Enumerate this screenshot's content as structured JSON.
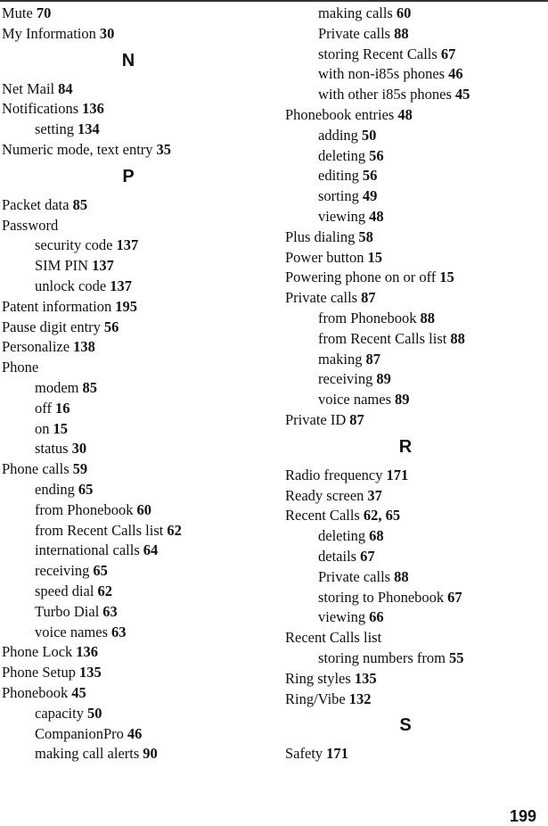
{
  "page_number": "199",
  "columns": [
    {
      "items": [
        {
          "type": "entry",
          "level": 0,
          "term": "Mute",
          "pages": "70"
        },
        {
          "type": "entry",
          "level": 0,
          "term": "My Information",
          "pages": "30"
        },
        {
          "type": "letter",
          "letter": "N"
        },
        {
          "type": "entry",
          "level": 0,
          "term": "Net Mail",
          "pages": "84"
        },
        {
          "type": "entry",
          "level": 0,
          "term": "Notifications",
          "pages": "136"
        },
        {
          "type": "entry",
          "level": 1,
          "term": "setting",
          "pages": "134"
        },
        {
          "type": "entry",
          "level": 0,
          "term": "Numeric mode, text entry",
          "pages": "35"
        },
        {
          "type": "letter",
          "letter": "P"
        },
        {
          "type": "entry",
          "level": 0,
          "term": "Packet data",
          "pages": "85"
        },
        {
          "type": "entry",
          "level": 0,
          "term": "Password",
          "pages": ""
        },
        {
          "type": "entry",
          "level": 1,
          "term": "security code",
          "pages": "137"
        },
        {
          "type": "entry",
          "level": 1,
          "term": "SIM PIN",
          "pages": "137"
        },
        {
          "type": "entry",
          "level": 1,
          "term": "unlock code",
          "pages": "137"
        },
        {
          "type": "entry",
          "level": 0,
          "term": "Patent information",
          "pages": "195"
        },
        {
          "type": "entry",
          "level": 0,
          "term": "Pause digit entry",
          "pages": "56"
        },
        {
          "type": "entry",
          "level": 0,
          "term": "Personalize",
          "pages": "138"
        },
        {
          "type": "entry",
          "level": 0,
          "term": "Phone",
          "pages": ""
        },
        {
          "type": "entry",
          "level": 1,
          "term": "modem",
          "pages": "85"
        },
        {
          "type": "entry",
          "level": 1,
          "term": "off",
          "pages": "16"
        },
        {
          "type": "entry",
          "level": 1,
          "term": "on",
          "pages": "15"
        },
        {
          "type": "entry",
          "level": 1,
          "term": "status",
          "pages": "30"
        },
        {
          "type": "entry",
          "level": 0,
          "term": "Phone calls",
          "pages": "59"
        },
        {
          "type": "entry",
          "level": 1,
          "term": "ending",
          "pages": "65"
        },
        {
          "type": "entry",
          "level": 1,
          "term": "from Phonebook",
          "pages": "60"
        },
        {
          "type": "entry",
          "level": 1,
          "term": "from Recent Calls list",
          "pages": "62"
        },
        {
          "type": "entry",
          "level": 1,
          "term": "international calls",
          "pages": "64"
        },
        {
          "type": "entry",
          "level": 1,
          "term": "receiving",
          "pages": "65"
        },
        {
          "type": "entry",
          "level": 1,
          "term": "speed dial",
          "pages": "62"
        },
        {
          "type": "entry",
          "level": 1,
          "term": "Turbo Dial",
          "pages": "63"
        },
        {
          "type": "entry",
          "level": 1,
          "term": "voice names",
          "pages": "63"
        },
        {
          "type": "entry",
          "level": 0,
          "term": "Phone Lock",
          "pages": "136"
        },
        {
          "type": "entry",
          "level": 0,
          "term": "Phone Setup",
          "pages": "135"
        },
        {
          "type": "entry",
          "level": 0,
          "term": "Phonebook",
          "pages": "45"
        },
        {
          "type": "entry",
          "level": 1,
          "term": "capacity",
          "pages": "50"
        },
        {
          "type": "entry",
          "level": 1,
          "term": "CompanionPro",
          "pages": "46"
        },
        {
          "type": "entry",
          "level": 1,
          "term": "making call alerts",
          "pages": "90"
        }
      ]
    },
    {
      "items": [
        {
          "type": "entry",
          "level": 1,
          "term": "making calls",
          "pages": "60"
        },
        {
          "type": "entry",
          "level": 1,
          "term": "Private calls",
          "pages": "88"
        },
        {
          "type": "entry",
          "level": 1,
          "term": "storing Recent Calls",
          "pages": "67"
        },
        {
          "type": "entry",
          "level": 1,
          "term": "with non-i85s phones",
          "pages": "46"
        },
        {
          "type": "entry",
          "level": 1,
          "term": "with other i85s phones",
          "pages": "45"
        },
        {
          "type": "entry",
          "level": 0,
          "term": "Phonebook entries",
          "pages": "48"
        },
        {
          "type": "entry",
          "level": 1,
          "term": "adding",
          "pages": "50"
        },
        {
          "type": "entry",
          "level": 1,
          "term": "deleting",
          "pages": "56"
        },
        {
          "type": "entry",
          "level": 1,
          "term": "editing",
          "pages": "56"
        },
        {
          "type": "entry",
          "level": 1,
          "term": "sorting",
          "pages": "49"
        },
        {
          "type": "entry",
          "level": 1,
          "term": "viewing",
          "pages": "48"
        },
        {
          "type": "entry",
          "level": 0,
          "term": "Plus dialing",
          "pages": "58"
        },
        {
          "type": "entry",
          "level": 0,
          "term": "Power button",
          "pages": "15"
        },
        {
          "type": "entry",
          "level": 0,
          "term": "Powering phone on or off",
          "pages": "15"
        },
        {
          "type": "entry",
          "level": 0,
          "term": "Private calls",
          "pages": "87"
        },
        {
          "type": "entry",
          "level": 1,
          "term": "from Phonebook",
          "pages": "88"
        },
        {
          "type": "entry",
          "level": 1,
          "term": "from Recent Calls list",
          "pages": "88"
        },
        {
          "type": "entry",
          "level": 1,
          "term": "making",
          "pages": "87"
        },
        {
          "type": "entry",
          "level": 1,
          "term": "receiving",
          "pages": "89"
        },
        {
          "type": "entry",
          "level": 1,
          "term": "voice names",
          "pages": "89"
        },
        {
          "type": "entry",
          "level": 0,
          "term": "Private ID",
          "pages": "87"
        },
        {
          "type": "letter",
          "letter": "R"
        },
        {
          "type": "entry",
          "level": 0,
          "term": "Radio frequency",
          "pages": "171"
        },
        {
          "type": "entry",
          "level": 0,
          "term": "Ready screen",
          "pages": "37"
        },
        {
          "type": "entry",
          "level": 0,
          "term": "Recent Calls",
          "pages": "62, 65"
        },
        {
          "type": "entry",
          "level": 1,
          "term": "deleting",
          "pages": "68"
        },
        {
          "type": "entry",
          "level": 1,
          "term": "details",
          "pages": "67"
        },
        {
          "type": "entry",
          "level": 1,
          "term": "Private calls",
          "pages": "88"
        },
        {
          "type": "entry",
          "level": 1,
          "term": "storing to Phonebook",
          "pages": "67"
        },
        {
          "type": "entry",
          "level": 1,
          "term": "viewing",
          "pages": "66"
        },
        {
          "type": "entry",
          "level": 0,
          "term": "Recent Calls list",
          "pages": ""
        },
        {
          "type": "entry",
          "level": 1,
          "term": "storing numbers from",
          "pages": "55"
        },
        {
          "type": "entry",
          "level": 0,
          "term": "Ring styles",
          "pages": "135"
        },
        {
          "type": "entry",
          "level": 0,
          "term": "Ring/Vibe",
          "pages": "132"
        },
        {
          "type": "letter",
          "letter": "S"
        },
        {
          "type": "entry",
          "level": 0,
          "term": "Safety",
          "pages": "171"
        }
      ]
    }
  ]
}
